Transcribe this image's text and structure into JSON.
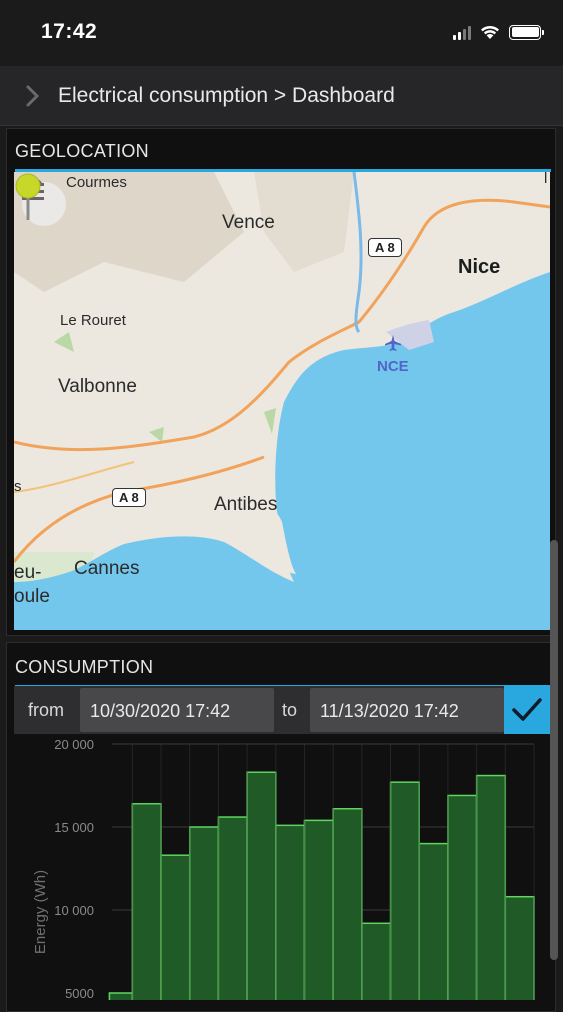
{
  "status_bar": {
    "time": "17:42"
  },
  "header": {
    "breadcrumb": "Electrical consumption > Dashboard"
  },
  "geolocation": {
    "title": "GEOLOCATION",
    "map": {
      "labels": {
        "courmes": "Courmes",
        "vence": "Vence",
        "nice": "Nice",
        "le_rouret": "Le Rouret",
        "valbonne": "Valbonne",
        "antibes": "Antibes",
        "cannes": "Cannes",
        "nce": "NCE",
        "edge_s": "s",
        "edge_eu": "eu-",
        "edge_oule": "oule",
        "edge_l": "l"
      },
      "road_shields": {
        "a8_north": "A 8",
        "a8_south": "A 8"
      }
    }
  },
  "consumption": {
    "title": "CONSUMPTION",
    "filter": {
      "from_label": "from",
      "from_value": "10/30/2020 17:42",
      "to_label": "to",
      "to_value": "11/13/2020 17:42"
    }
  },
  "colors": {
    "accent": "#29a8e0",
    "bar_fill": "#1f5a27",
    "bar_stroke": "#5fd45f",
    "sea": "#74c7ec"
  },
  "chart_data": {
    "type": "bar",
    "ylabel": "Energy (Wh)",
    "yticks": [
      "20 000",
      "15 000",
      "10 000",
      "5000"
    ],
    "ytick_values": [
      20000,
      15000,
      10000,
      5000
    ],
    "ylim_visible": [
      5000,
      20000
    ],
    "values": [
      5000,
      16400,
      13300,
      15000,
      15600,
      18300,
      15100,
      15400,
      16100,
      9200,
      17700,
      14000,
      16900,
      18100,
      10800
    ]
  }
}
